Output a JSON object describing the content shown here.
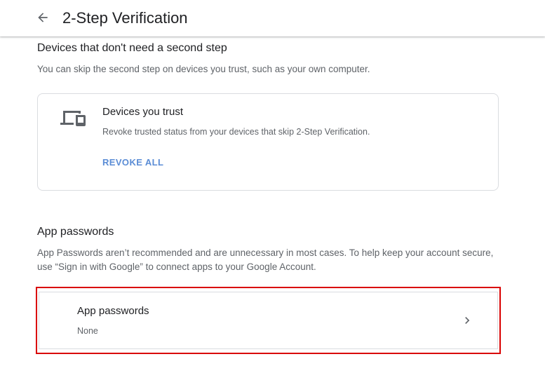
{
  "header": {
    "title": "2-Step Verification",
    "back_icon": "arrow-back-icon"
  },
  "devices_section": {
    "heading": "Devices that don't need a second step",
    "description": "You can skip the second step on devices you trust, such as your own computer.",
    "card": {
      "icon": "devices-icon",
      "title": "Devices you trust",
      "description": "Revoke trusted status from your devices that skip 2-Step Verification.",
      "action_label": "REVOKE ALL"
    }
  },
  "app_passwords_section": {
    "heading": "App passwords",
    "description": "App Passwords aren’t recommended and are unnecessary in most cases. To help keep your account secure, use “Sign in with Google” to connect apps to your Google Account.",
    "row": {
      "title": "App passwords",
      "value": "None",
      "icon": "chevron-right-icon"
    }
  },
  "colors": {
    "link": "#5b8dd6",
    "highlight": "#d90000",
    "text_primary": "#202124",
    "text_secondary": "#5f6368",
    "border": "#dadce0"
  }
}
